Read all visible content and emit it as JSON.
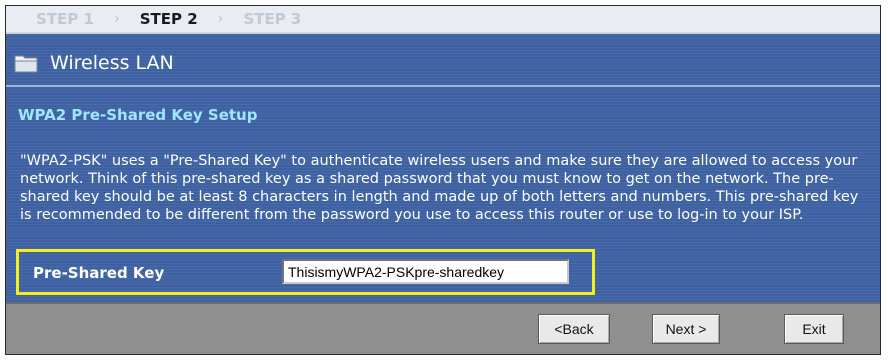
{
  "steps": {
    "step1": "STEP 1",
    "step2": "STEP 2",
    "step3": "STEP 3",
    "separator": "›"
  },
  "header": {
    "icon": "folder-icon",
    "title": "Wireless LAN"
  },
  "section": {
    "title": "WPA2 Pre-Shared Key Setup",
    "description": "\"WPA2-PSK\" uses a \"Pre-Shared Key\" to authenticate wireless users and make sure they are allowed to access your network. Think of this pre-shared key as a shared password that you must know to get on the network. The pre-shared key should be at least 8 characters in length and made up of both letters and numbers. This pre-shared key is recommended to be different from the password you use to access this router or use to log-in to your ISP."
  },
  "form": {
    "psk_label": "Pre-Shared Key",
    "psk_value": "ThisismyWPA2-PSKpre-sharedkey"
  },
  "buttons": {
    "back": "<Back",
    "next": "Next >",
    "exit": "Exit"
  },
  "colors": {
    "panel_bg": "#3d61a1",
    "section_title": "#9fe7ff",
    "highlight_border": "#f5ee1b",
    "button_bar": "#8f8f8f"
  }
}
